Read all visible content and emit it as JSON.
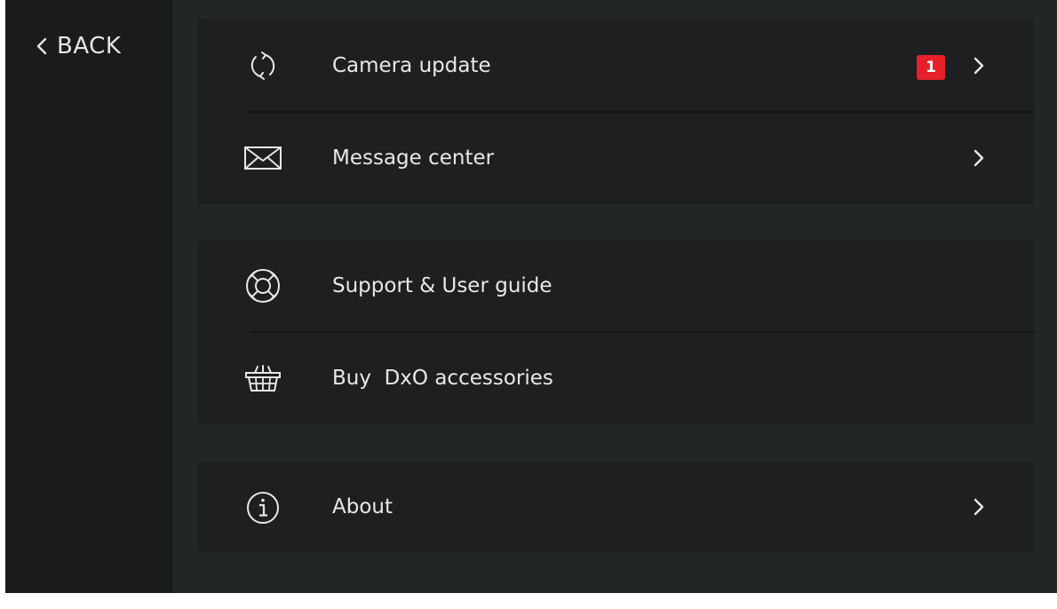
{
  "nav": {
    "back_label": "BACK"
  },
  "menu": {
    "groups": [
      {
        "items": [
          {
            "label": "Camera update",
            "icon": "refresh-icon",
            "badge": "1",
            "has_chevron": true
          },
          {
            "label": "Message center",
            "icon": "envelope-icon",
            "has_chevron": true
          }
        ]
      },
      {
        "items": [
          {
            "label": "Support & User guide",
            "icon": "lifebuoy-icon",
            "has_chevron": false
          },
          {
            "label": "Buy  DxO accessories",
            "icon": "basket-icon",
            "has_chevron": false
          }
        ]
      },
      {
        "items": [
          {
            "label": "About",
            "icon": "info-icon",
            "has_chevron": true
          }
        ]
      }
    ]
  },
  "colors": {
    "background": "#222627",
    "sidebar": "#1a1c1c",
    "card": "#1e1f20",
    "text": "#e8e8e8",
    "badge": "#e8202a"
  }
}
